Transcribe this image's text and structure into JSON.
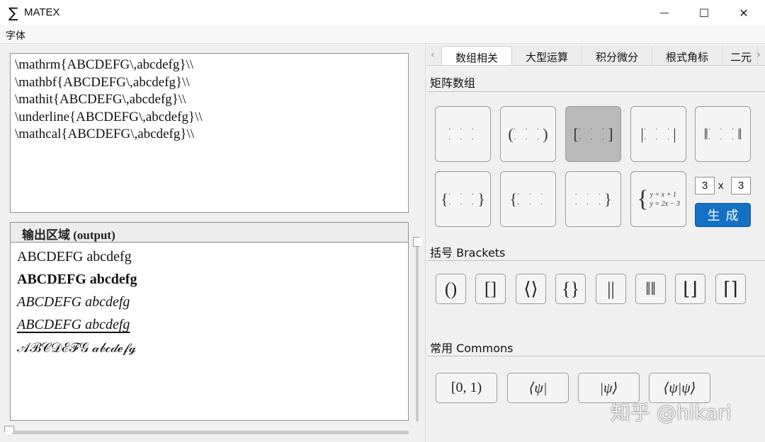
{
  "window": {
    "title": "MATEX",
    "icon_glyph": "∑",
    "minimize_glyph": "—",
    "maximize_glyph": "☐",
    "close_glyph": "✕"
  },
  "menu": {
    "items": [
      "字体"
    ]
  },
  "editor": {
    "lines": [
      "\\mathrm{ABCDEFG\\,abcdefg}\\\\",
      "\\mathbf{ABCDEFG\\,abcdefg}\\\\",
      "\\mathit{ABCDEFG\\,abcdefg}\\\\",
      "\\underline{ABCDEFG\\,abcdefg}\\\\",
      "\\mathcal{ABCDEFG\\,abcdefg}\\\\"
    ]
  },
  "output": {
    "title": "输出区域 (output)",
    "lines": [
      "ABCDEFG abcdefg",
      "ABCDEFG abcdefg",
      "ABCDEFG abcdefg",
      "ABCDEFG abcdefg",
      "𝒜ℬ𝒞𝒟ℰℱ𝒢 𝒶𝒷𝒸𝒹ℯ𝒻ℊ"
    ]
  },
  "tabs": [
    "数组相关",
    "大型运算",
    "积分微分",
    "根式角标",
    "二元"
  ],
  "active_tab": 0,
  "tab_arrows": {
    "left": "‹",
    "right": "›"
  },
  "matrix_section": {
    "label": "矩阵数组",
    "buttons": [
      {
        "left": "",
        "right": "",
        "selected": false
      },
      {
        "left": "(",
        "right": ")",
        "selected": false
      },
      {
        "left": "[",
        "right": "]",
        "selected": true
      },
      {
        "left": "|",
        "right": "|",
        "selected": false
      },
      {
        "left": "‖",
        "right": "‖",
        "selected": false
      },
      {
        "left": "{",
        "right": "}",
        "selected": false
      },
      {
        "left": "{",
        "right": "",
        "selected": false
      },
      {
        "left": "",
        "right": "}",
        "selected": false
      }
    ],
    "dots_row": "· · ·",
    "system_eq": {
      "brace": "{",
      "line1": "y = x + 1",
      "line2": "y = 2x − 3"
    },
    "rows": "3",
    "cols": "3",
    "times": "x",
    "generate_label": "生成"
  },
  "brackets_section": {
    "label": "括号 Brackets",
    "buttons": [
      "()",
      "[]",
      "⟨⟩",
      "{}",
      "||",
      "‖‖",
      "⌊⌋",
      "⌈⌉"
    ]
  },
  "commons_section": {
    "label": "常用 Commons",
    "buttons": [
      "[0, 1)",
      "⟨ψ|",
      "|ψ⟩",
      "⟨ψ|ψ⟩"
    ]
  },
  "watermark": "知乎 @hikari",
  "colors": {
    "accent": "#1370c3",
    "selected": "#b9b9b9"
  }
}
